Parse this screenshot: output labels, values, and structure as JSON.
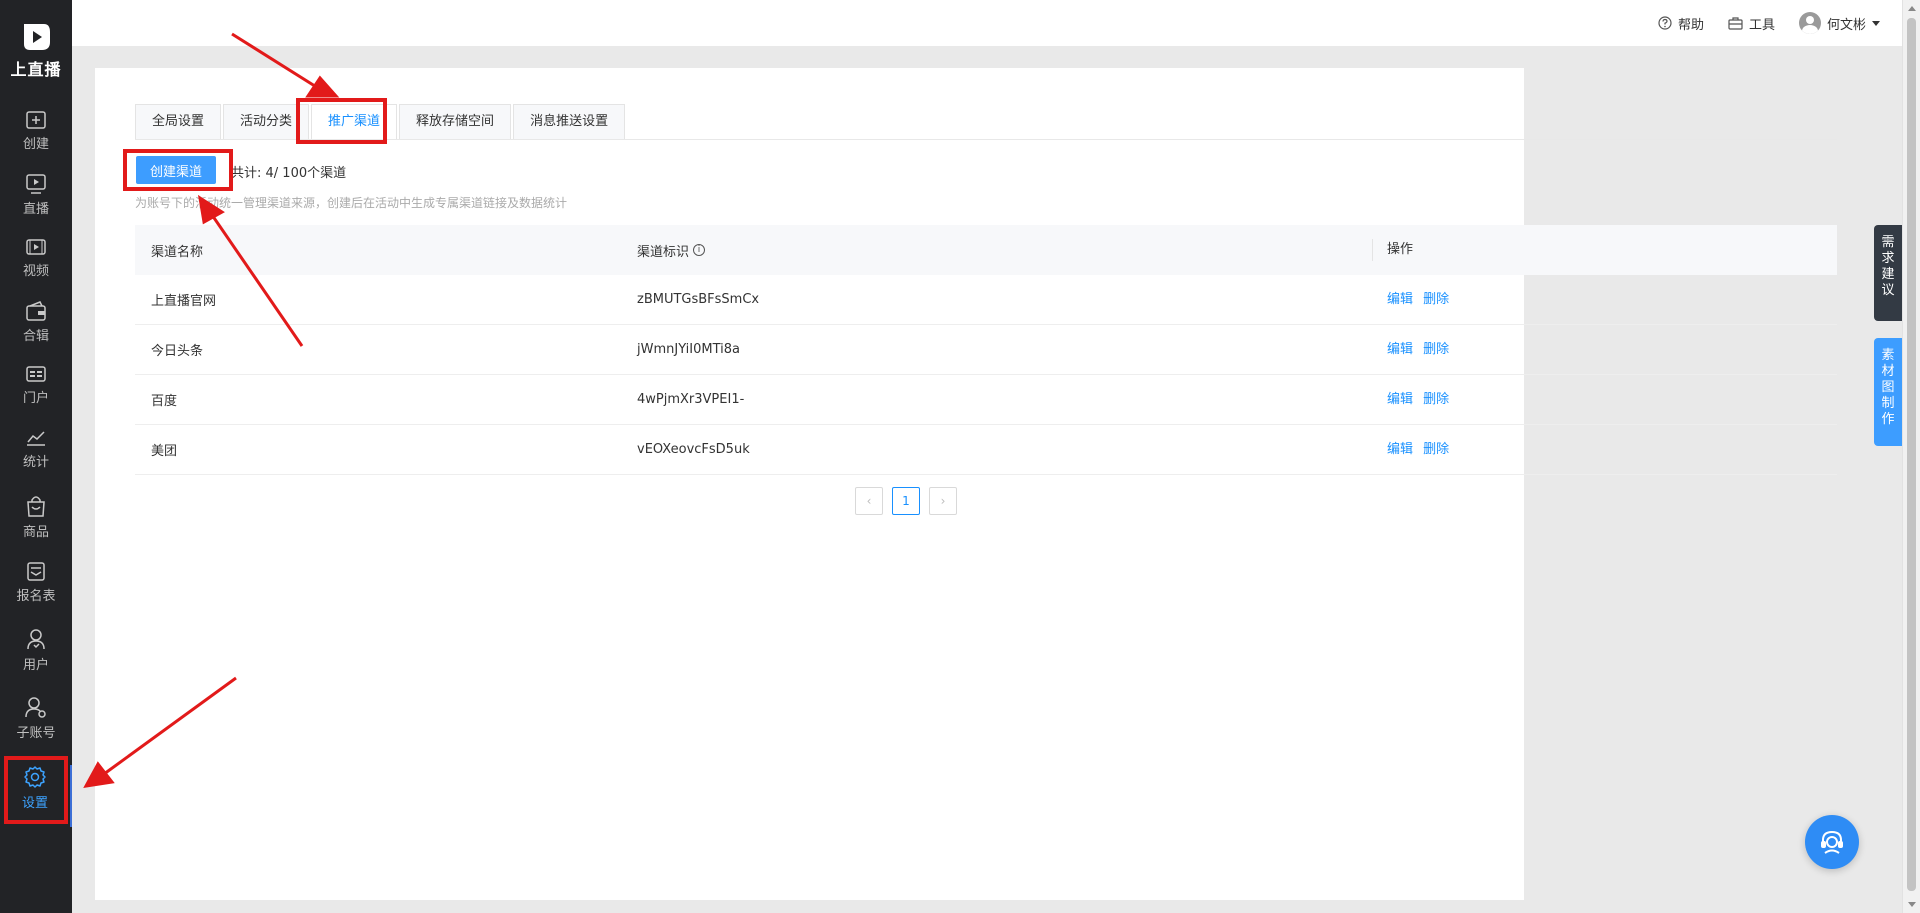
{
  "app": {
    "logo_text": "上直播",
    "brand_color": "#3d9dff"
  },
  "sidebar": {
    "items": [
      {
        "label": "创建",
        "icon": "plus-square-icon"
      },
      {
        "label": "直播",
        "icon": "live-play-icon"
      },
      {
        "label": "视频",
        "icon": "video-icon"
      },
      {
        "label": "合辑",
        "icon": "collection-icon"
      },
      {
        "label": "门户",
        "icon": "portal-icon"
      },
      {
        "label": "统计",
        "icon": "chart-icon"
      },
      {
        "label": "商品",
        "icon": "shopping-bag-icon"
      },
      {
        "label": "报名表",
        "icon": "form-icon"
      },
      {
        "label": "用户",
        "icon": "user-icon"
      },
      {
        "label": "子账号",
        "icon": "sub-account-icon"
      },
      {
        "label": "设置",
        "icon": "gear-icon",
        "active": true
      }
    ]
  },
  "header": {
    "help": "帮助",
    "tools": "工具",
    "username": "何文彬"
  },
  "tabs": [
    {
      "label": "全局设置"
    },
    {
      "label": "活动分类"
    },
    {
      "label": "推广渠道",
      "active": true
    },
    {
      "label": "释放存储空间"
    },
    {
      "label": "消息推送设置"
    }
  ],
  "toolbar": {
    "create_label": "创建渠道",
    "count_text": "共计:  4/ 100个渠道",
    "hint": "为账号下的活动统一管理渠道来源，创建后在活动中生成专属渠道链接及数据统计"
  },
  "table": {
    "columns": [
      "渠道名称",
      "渠道标识",
      "操作"
    ],
    "rows": [
      {
        "name": "上直播官网",
        "id": "zBMUTGsBFsSmCx"
      },
      {
        "name": "今日头条",
        "id": "jWmnJYiI0MTi8a"
      },
      {
        "name": "百度",
        "id": "4wPjmXr3VPEI1-"
      },
      {
        "name": "美团",
        "id": "vEOXeovcFsD5uk"
      }
    ],
    "edit_label": "编辑",
    "delete_label": "删除"
  },
  "pagination": {
    "current": "1"
  },
  "float": {
    "suggest": [
      "需",
      "求",
      "建",
      "议"
    ],
    "material": [
      "素",
      "材",
      "图",
      "制",
      "作"
    ]
  },
  "annotation_color": "#e21a1a"
}
